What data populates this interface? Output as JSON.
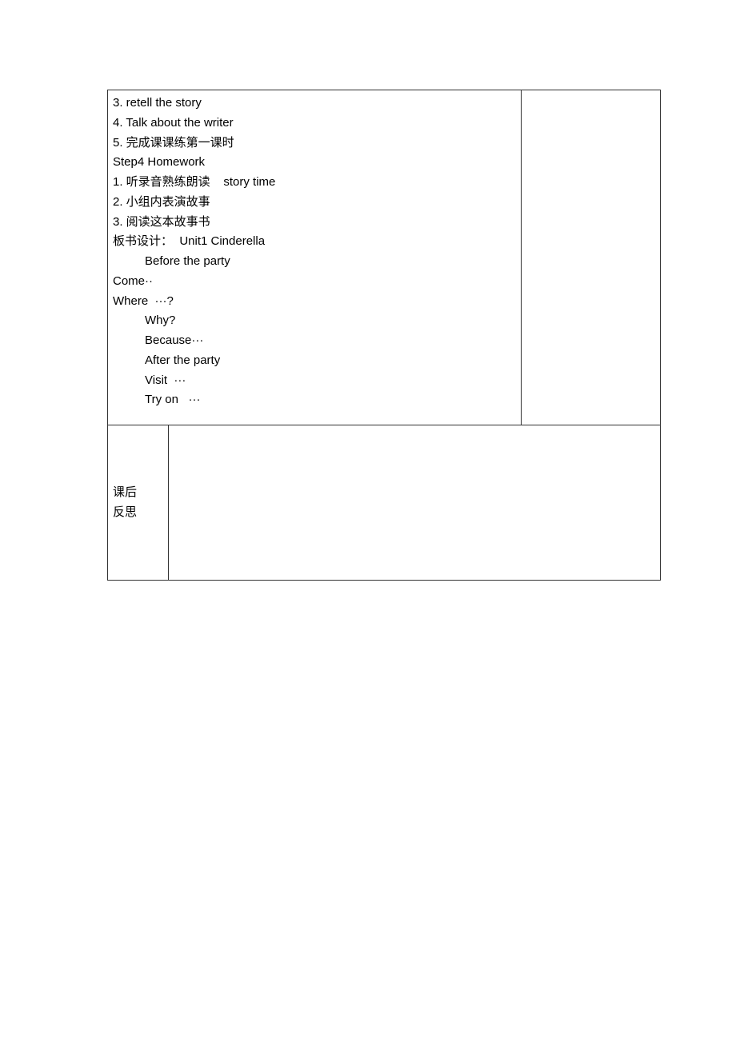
{
  "content": {
    "line1": "3. retell the story",
    "line2": "4. Talk about the writer",
    "line3": "5. 完成课课练第一课时",
    "line4": "Step4 Homework",
    "line5": "1. 听录音熟练朗读    story time",
    "line6": "2. 小组内表演故事",
    "line7": "3. 阅读这本故事书",
    "line8": "板书设计：  Unit1 Cinderella",
    "line9": "Before the party",
    "line10": "Come··",
    "line11": "Where  ···?",
    "line12": "Why?",
    "line13": "Because···",
    "line14": "After the party",
    "line15": "Visit  ···",
    "line16": "Try on   ···"
  },
  "reflection": {
    "label_line1": "课后",
    "label_line2": "反思"
  }
}
